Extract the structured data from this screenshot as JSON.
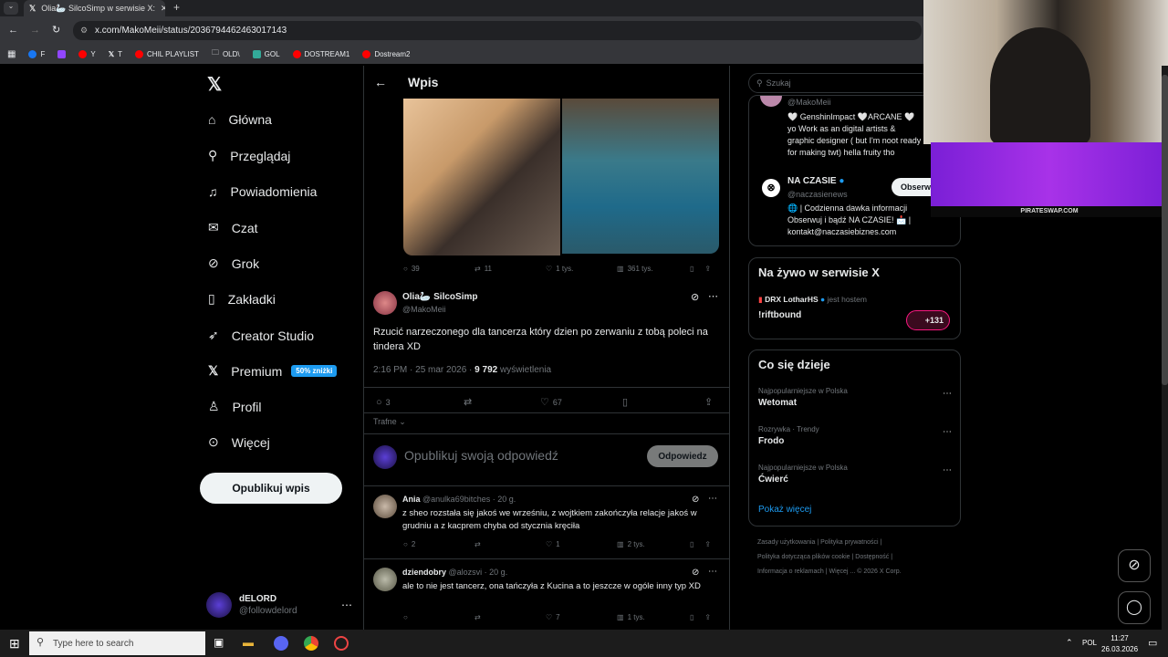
{
  "browser": {
    "tab_title": "Olia🦢 SilcoSimp w serwisie X:",
    "url": "x.com/MakoMeii/status/2036794462463017143",
    "bookmarks": [
      "F",
      "Y",
      "T",
      "CHIL PLAYLIST",
      "OLD\\",
      "GOL",
      "DOSTREAM1",
      "Dostream2"
    ]
  },
  "nav": {
    "items": [
      "Główna",
      "Przeglądaj",
      "Powiadomienia",
      "Czat",
      "Grok",
      "Zakładki",
      "Creator Studio",
      "Premium",
      "Profil",
      "Więcej"
    ],
    "premium_badge": "50% zniżki",
    "post_button": "Opublikuj wpis",
    "account_name": "dELORD",
    "account_handle": "@followdelord"
  },
  "main": {
    "header_title": "Wpis",
    "quoted_stats": {
      "replies": "39",
      "reposts": "11",
      "likes": "1 tys.",
      "views": "361 tys."
    },
    "post": {
      "author": "Olia🦢 SilcoSimp",
      "handle": "@MakoMeii",
      "text": "Rzucić narzeczonego dla tancerza który dzien po zerwaniu z tobą poleci na tindera XD",
      "meta_time": "2:16 PM · 25 mar 2026 · ",
      "views_count": "9 792",
      "views_label": " wyświetlenia",
      "replies": "3",
      "likes": "67"
    },
    "sort_label": "Trafne",
    "reply_placeholder": "Opublikuj swoją odpowiedź",
    "reply_button": "Odpowiedz",
    "replies": [
      {
        "name": "Ania",
        "handle": "@anulka69bitches · 20 g.",
        "text": "z sheo rozstała się jakoś we wrześniu, z wojtkiem zakończyła relacje jakoś w grudniu a z kacprem chyba od stycznia kręciła",
        "replies": "2",
        "likes": "1",
        "views": "2 tys."
      },
      {
        "name": "dziendobry",
        "handle": "@alozsvi · 20 g.",
        "text": "ale to nie jest tancerz, ona tańczyła z Kucina a to jeszcze w ogóle inny typ XD",
        "replies": "",
        "likes": "7",
        "views": "1 tys."
      }
    ]
  },
  "right": {
    "search_placeholder": "Szukaj",
    "who_to_follow": {
      "top_handle": "@MakoMeii",
      "top_bio": "🤍 GenshinImpact 🤍ARCANE 🤍 yo Work as an digital artists & graphic designer ( but I'm noot ready for making twt) hella fruity tho",
      "name": "NA CZASIE",
      "handle": "@naczasienews",
      "follow_button": "Obserwuj",
      "bio": "🌐 | Codzienna dawka informacji Obserwuj i bądź NA CZASIE! 📩 | kontakt@naczasiebiznes.com"
    },
    "live": {
      "title": "Na żywo w serwisie X",
      "host": "DRX LotharHS",
      "host_suffix": "jest hostem",
      "stream": "!riftbound",
      "count": "+131"
    },
    "trends": {
      "title": "Co się dzieje",
      "items": [
        {
          "context": "Najpopularniejsze w Polska",
          "name": "Wetomat"
        },
        {
          "context": "Rozrywka · Trendy",
          "name": "Frodo"
        },
        {
          "context": "Najpopularniejsze w Polska",
          "name": "Ćwierć"
        }
      ],
      "show_more": "Pokaż więcej"
    },
    "footer": [
      "Zasady użytkowania",
      "Polityka prywatności",
      "Polityka dotycząca plików cookie",
      "Dostępność",
      "Informacja o reklamach",
      "Więcej ...",
      "© 2026 X Corp."
    ]
  },
  "overlay": {
    "brand": "PIRATESWAP.COM"
  },
  "taskbar": {
    "search": "Type here to search",
    "lang": "POL",
    "time": "11:27",
    "date": "26.03.2026"
  },
  "colors": {
    "accent": "#1d9bf0",
    "background": "#000000",
    "border": "#2f3336"
  }
}
